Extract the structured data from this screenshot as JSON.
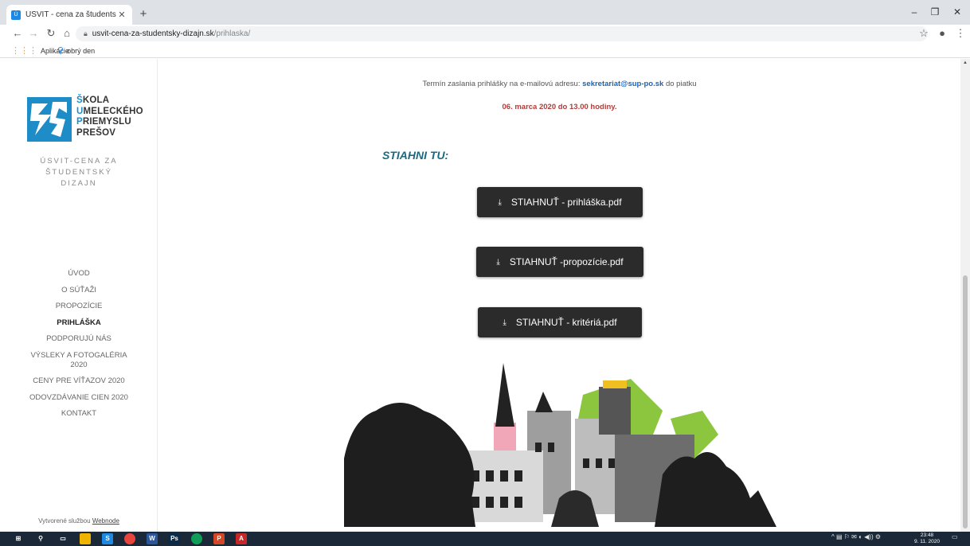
{
  "browser": {
    "tab_title": "ÚSVIT - cena za študentský dizajn",
    "tab_close": "✕",
    "new_tab": "+",
    "url_host": "usvit-cena-za-studentsky-dizajn.sk",
    "url_path": "/prihlaska/",
    "bookmarks": [
      {
        "icon": "apps-grid-icon",
        "label": "Aplikácie"
      },
      {
        "icon": "bookmark-user-icon",
        "label": "obrý den"
      }
    ]
  },
  "sidebar": {
    "logo_lines": [
      {
        "cap": "Š",
        "rest": "KOLA"
      },
      {
        "cap": "U",
        "rest": "MELECKÉHO"
      },
      {
        "cap": "P",
        "rest": "RIEMYSLU"
      },
      {
        "cap": "",
        "rest": "PREŠOV"
      }
    ],
    "site_name": "ÚSVIT-CENA ZA ŠTUDENTSKÝ DIZAJN",
    "nav": [
      {
        "label": "ÚVOD",
        "active": false
      },
      {
        "label": "O SÚŤAŽI",
        "active": false
      },
      {
        "label": "PROPOZÍCIE",
        "active": false
      },
      {
        "label": "PRIHLÁŠKA",
        "active": true
      },
      {
        "label": "PODPORUJÚ NÁS",
        "active": false
      },
      {
        "label": "VÝSLEKY A FOTOGALÉRIA 2020",
        "active": false
      },
      {
        "label": "CENY PRE VÍŤAZOV 2020",
        "active": false
      },
      {
        "label": "ODOVZDÁVANIE CIEN 2020",
        "active": false
      },
      {
        "label": "KONTAKT",
        "active": false
      }
    ],
    "credit_prefix": "Vytvorené službou",
    "credit_link": "Webnode"
  },
  "main": {
    "deadline_prefix": "Termín zaslania prihlášky na e-mailovú adresu:",
    "deadline_email": "sekretariat@sup-po.sk",
    "deadline_suffix": "do piatku",
    "deadline_date": "06. marca 2020 do 13.00 hodiny.",
    "heading": "STIAHNI TU:",
    "downloads": [
      {
        "label": "STIAHNUŤ - prihláška.pdf"
      },
      {
        "label": "STIAHNUŤ -propozície.pdf"
      },
      {
        "label": "STIAHNUŤ - kritériá.pdf"
      }
    ]
  },
  "taskbar": {
    "time": "23:48",
    "date": "9. 11. 2020"
  },
  "colors": {
    "accent_blue": "#1d8cc7",
    "heading_teal": "#1b6a80",
    "date_red": "#b23b3b",
    "button_dark": "#2b2b2b",
    "art_green": "#8cc63f"
  }
}
